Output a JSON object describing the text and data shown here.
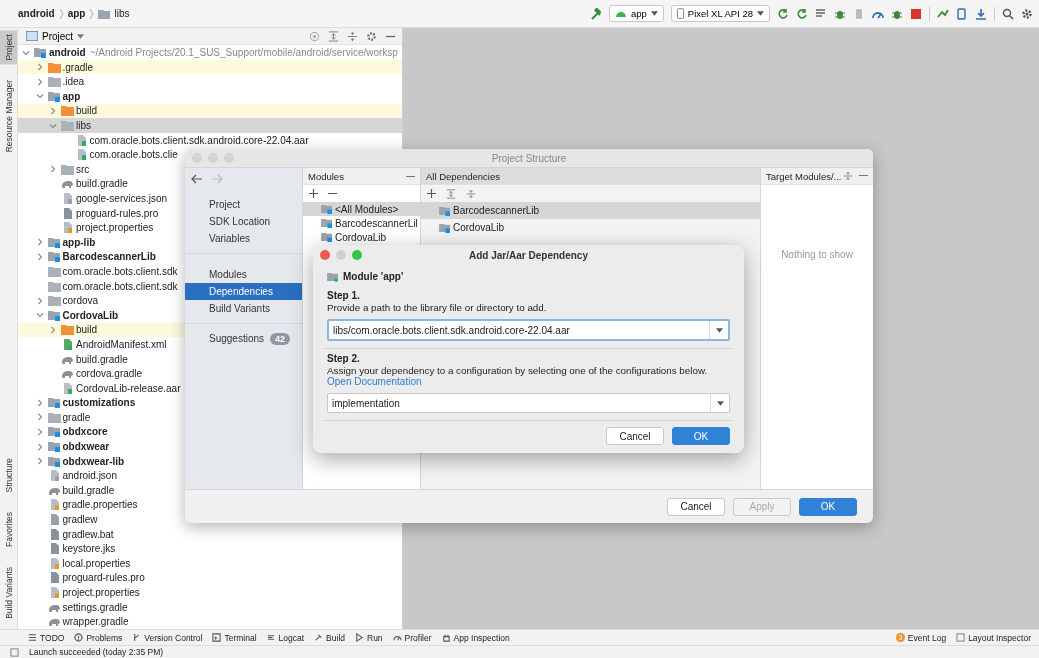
{
  "breadcrumbs": [
    {
      "label": "android"
    },
    {
      "label": "app"
    },
    {
      "label": "libs"
    }
  ],
  "toolbar": {
    "run_config": "app",
    "device": "Pixel XL API 28"
  },
  "side_tabs_top": [
    {
      "label": "Project",
      "selected": true
    },
    {
      "label": "Resource Manager",
      "selected": false
    }
  ],
  "side_tabs_bottom": [
    {
      "label": "Structure",
      "selected": false
    },
    {
      "label": "Favorites",
      "selected": false
    },
    {
      "label": "Build Variants",
      "selected": false
    }
  ],
  "project_panel": {
    "title": "Project",
    "tree": [
      {
        "label": "android",
        "hint": "~/Android Projects/20.1_SUS_Support/mobile/android/service/worksp",
        "kind": "module",
        "expanded": true,
        "selected": false,
        "children": [
          {
            "label": ".gradle",
            "kind": "excluded",
            "expanded": false,
            "selected": false
          },
          {
            "label": ".idea",
            "kind": "folder",
            "expanded": false,
            "selected": false
          },
          {
            "label": "app",
            "kind": "module",
            "expanded": true,
            "selected": false,
            "children": [
              {
                "label": "build",
                "kind": "excluded",
                "expanded": false,
                "selected": false
              },
              {
                "label": "libs",
                "kind": "folder",
                "expanded": true,
                "selected": true,
                "children": [
                  {
                    "label": "com.oracle.bots.client.sdk.android.core-22.04.aar",
                    "kind": "archive",
                    "selected": false
                  },
                  {
                    "label": "com.oracle.bots.clie",
                    "kind": "archive",
                    "selected": false
                  }
                ]
              },
              {
                "label": "src",
                "kind": "folder",
                "expanded": false,
                "selected": false
              },
              {
                "label": "build.gradle",
                "kind": "gradle",
                "selected": false
              },
              {
                "label": "google-services.json",
                "kind": "json",
                "selected": false
              },
              {
                "label": "proguard-rules.pro",
                "kind": "text",
                "selected": false
              },
              {
                "label": "project.properties",
                "kind": "properties",
                "selected": false
              }
            ]
          },
          {
            "label": "app-lib",
            "kind": "module",
            "expanded": false,
            "selected": false
          },
          {
            "label": "BarcodescannerLib",
            "kind": "module",
            "expanded": false,
            "selected": false
          },
          {
            "label": "com.oracle.bots.client.sdk",
            "kind": "folder",
            "selected": false
          },
          {
            "label": "com.oracle.bots.client.sdk",
            "kind": "folder",
            "selected": false
          },
          {
            "label": "cordova",
            "kind": "folder",
            "expanded": false,
            "selected": false
          },
          {
            "label": "CordovaLib",
            "kind": "module",
            "expanded": true,
            "selected": false,
            "children": [
              {
                "label": "build",
                "kind": "excluded",
                "expanded": false,
                "selected": false
              },
              {
                "label": "AndroidManifest.xml",
                "kind": "xml",
                "selected": false
              },
              {
                "label": "build.gradle",
                "kind": "gradle",
                "selected": false
              },
              {
                "label": "cordova.gradle",
                "kind": "gradle",
                "selected": false
              },
              {
                "label": "CordovaLib-release.aar",
                "kind": "archive",
                "selected": false
              }
            ]
          },
          {
            "label": "customizations",
            "kind": "module",
            "expanded": false,
            "selected": false
          },
          {
            "label": "gradle",
            "kind": "folder",
            "expanded": false,
            "selected": false
          },
          {
            "label": "obdxcore",
            "kind": "module",
            "expanded": false,
            "selected": false
          },
          {
            "label": "obdxwear",
            "kind": "module",
            "expanded": false,
            "selected": false
          },
          {
            "label": "obdxwear-lib",
            "kind": "module",
            "expanded": false,
            "selected": false
          },
          {
            "label": "android.json",
            "kind": "json",
            "selected": false
          },
          {
            "label": "build.gradle",
            "kind": "gradle",
            "selected": false
          },
          {
            "label": "gradle.properties",
            "kind": "properties",
            "selected": false
          },
          {
            "label": "gradlew",
            "kind": "script",
            "selected": false
          },
          {
            "label": "gradlew.bat",
            "kind": "text",
            "selected": false
          },
          {
            "label": "keystore.jks",
            "kind": "text",
            "selected": false
          },
          {
            "label": "local.properties",
            "kind": "properties",
            "selected": false
          },
          {
            "label": "proguard-rules.pro",
            "kind": "text",
            "selected": false
          },
          {
            "label": "project.properties",
            "kind": "properties",
            "selected": false
          },
          {
            "label": "settings.gradle",
            "kind": "gradle",
            "selected": false
          },
          {
            "label": "wrapper.gradle",
            "kind": "gradle",
            "selected": false
          }
        ]
      }
    ]
  },
  "project_structure": {
    "title": "Project Structure",
    "nav_groups": [
      {
        "items": [
          {
            "label": "Project",
            "selected": false
          },
          {
            "label": "SDK Location",
            "selected": false
          },
          {
            "label": "Variables",
            "selected": false
          }
        ]
      },
      {
        "items": [
          {
            "label": "Modules",
            "selected": false
          },
          {
            "label": "Dependencies",
            "selected": true
          },
          {
            "label": "Build Variants",
            "selected": false
          }
        ]
      }
    ],
    "suggestions": {
      "label": "Suggestions",
      "count": "42"
    },
    "modules": {
      "title": "Modules",
      "items": [
        {
          "label": "<All Modules>",
          "selected": true
        },
        {
          "label": "BarcodescannerLil",
          "selected": false
        },
        {
          "label": "CordovaLib",
          "selected": false
        }
      ]
    },
    "dependencies": {
      "title": "All Dependencies",
      "items": [
        {
          "label": "BarcodescannerLib",
          "selected": true
        },
        {
          "label": "CordovaLib",
          "selected": false
        }
      ]
    },
    "target": {
      "title": "Target Modules/...",
      "empty": "Nothing to show"
    },
    "buttons": [
      {
        "label": "Cancel",
        "kind": "default",
        "disabled": false
      },
      {
        "label": "Apply",
        "kind": "default",
        "disabled": true
      },
      {
        "label": "OK",
        "kind": "primary",
        "disabled": false
      }
    ]
  },
  "add_dependency": {
    "title": "Add Jar/Aar Dependency",
    "module": "Module 'app'",
    "step1": {
      "heading": "Step 1.",
      "text": "Provide a path to the library file or directory to add.",
      "value": "libs/com.oracle.bots.client.sdk.android.core-22.04.aar"
    },
    "step2": {
      "heading": "Step 2.",
      "text": "Assign your dependency to a configuration by selecting one of the configurations below.",
      "link": "Open Documentation",
      "value": "implementation"
    },
    "buttons": [
      {
        "label": "Cancel",
        "kind": "default"
      },
      {
        "label": "OK",
        "kind": "primary"
      }
    ]
  },
  "bottom_tools": [
    {
      "label": "TODO",
      "kind": "list"
    },
    {
      "label": "Problems",
      "kind": "problems"
    },
    {
      "label": "Version Control",
      "kind": "vcs"
    },
    {
      "label": "Terminal",
      "kind": "terminal"
    },
    {
      "label": "Logcat",
      "kind": "logcat"
    },
    {
      "label": "Build",
      "kind": "build"
    },
    {
      "label": "Run",
      "kind": "run"
    },
    {
      "label": "Profiler",
      "kind": "profiler"
    },
    {
      "label": "App Inspection",
      "kind": "inspection"
    }
  ],
  "right_tools": [
    {
      "label": "Event Log",
      "badge": "3"
    },
    {
      "label": "Layout Inspector"
    }
  ],
  "status": "Launch succeeded (today 2:35 PM)"
}
